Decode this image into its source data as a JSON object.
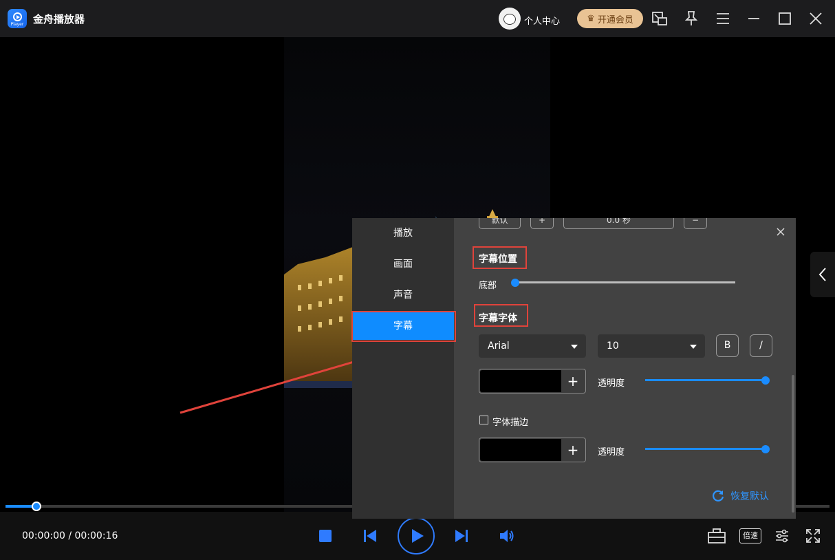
{
  "app": {
    "title": "金舟播放器",
    "logo_sub": "Player"
  },
  "header": {
    "user_center": "个人中心",
    "vip_label": "开通会员"
  },
  "player": {
    "time": "00:00:00 / 00:00:16",
    "speed_label": "倍速",
    "progress_fraction": 0.032
  },
  "settings": {
    "nav": [
      "播放",
      "画面",
      "声音",
      "字幕"
    ],
    "active_nav": "字幕",
    "top_row": {
      "default_label": "默认",
      "offset_value": "0.0 秒"
    },
    "position": {
      "title": "字幕位置",
      "label": "底部",
      "value_fraction": 0.0
    },
    "font": {
      "title": "字幕字体",
      "family": "Arial",
      "size": "10",
      "bold_label": "B",
      "italic_label": "/",
      "opacity_label": "透明度",
      "color": "#000000",
      "opacity_fraction": 1.0
    },
    "outline": {
      "checkbox_label": "字体描边",
      "checked": false,
      "opacity_label": "透明度",
      "color": "#000000",
      "opacity_fraction": 1.0
    },
    "reset_label": "恢复默认"
  },
  "colors": {
    "accent": "#0f8cff",
    "highlight_box": "#e0433b",
    "vip_bg": "#e9c394"
  }
}
